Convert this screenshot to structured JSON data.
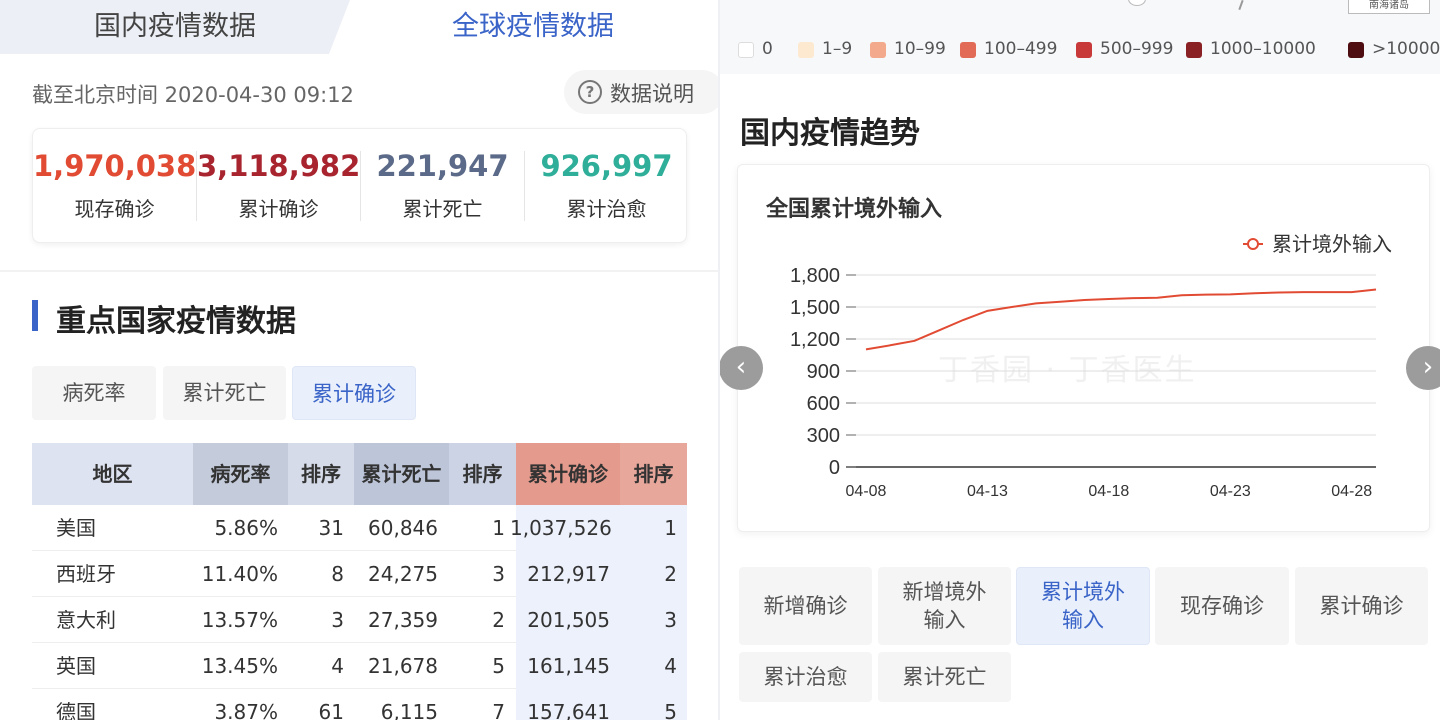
{
  "tabs": {
    "domestic": "国内疫情数据",
    "global": "全球疫情数据"
  },
  "timestamp": "截至北京时间 2020-04-30 09:12",
  "data_info": {
    "icon": "?",
    "label": "数据说明"
  },
  "stats": [
    {
      "value": "1,970,038",
      "label": "现存确诊",
      "color": "#e24b33"
    },
    {
      "value": "3,118,982",
      "label": "累计确诊",
      "color": "#a8242e"
    },
    {
      "value": "221,947",
      "label": "累计死亡",
      "color": "#5b6a88"
    },
    {
      "value": "926,997",
      "label": "累计治愈",
      "color": "#2fae9a"
    }
  ],
  "section_title": "重点国家疫情数据",
  "segments": [
    "病死率",
    "累计死亡",
    "累计确诊"
  ],
  "table": {
    "headers": [
      "地区",
      "病死率",
      "排序",
      "累计死亡",
      "排序",
      "累计确诊",
      "排序"
    ],
    "rows": [
      [
        "美国",
        "5.86%",
        "31",
        "60,846",
        "1",
        "1,037,526",
        "1"
      ],
      [
        "西班牙",
        "11.40%",
        "8",
        "24,275",
        "3",
        "212,917",
        "2"
      ],
      [
        "意大利",
        "13.57%",
        "3",
        "27,359",
        "2",
        "201,505",
        "3"
      ],
      [
        "英国",
        "13.45%",
        "4",
        "21,678",
        "5",
        "161,145",
        "4"
      ],
      [
        "德国",
        "3.87%",
        "61",
        "6,115",
        "7",
        "157,641",
        "5"
      ]
    ]
  },
  "map": {
    "nanhai_label": "南海诸岛"
  },
  "map_legend": [
    {
      "label": "0",
      "color": "#ffffff"
    },
    {
      "label": "1–9",
      "color": "#fde9cf"
    },
    {
      "label": "10–99",
      "color": "#f3a98c"
    },
    {
      "label": "100–499",
      "color": "#e26b57"
    },
    {
      "label": "500–999",
      "color": "#c8393a"
    },
    {
      "label": "1000–10000",
      "color": "#8a2124"
    },
    {
      "label": ">10000",
      "color": "#4e0d10"
    }
  ],
  "trend_title": "国内疫情趋势",
  "chart_data": {
    "type": "line",
    "title": "全国累计境外输入",
    "xlabel": "",
    "ylabel": "",
    "x": [
      "04-08",
      "04-09",
      "04-10",
      "04-11",
      "04-12",
      "04-13",
      "04-14",
      "04-15",
      "04-16",
      "04-17",
      "04-18",
      "04-19",
      "04-20",
      "04-21",
      "04-22",
      "04-23",
      "04-24",
      "04-25",
      "04-26",
      "04-27",
      "04-28",
      "04-29"
    ],
    "x_tick_labels": [
      "04-08",
      "04-13",
      "04-18",
      "04-23",
      "04-28"
    ],
    "series": [
      {
        "name": "累计境外输入",
        "color": "#e24b33",
        "values": [
          1103,
          1141,
          1183,
          1280,
          1378,
          1464,
          1500,
          1534,
          1549,
          1566,
          1575,
          1583,
          1587,
          1610,
          1616,
          1618,
          1629,
          1636,
          1639,
          1640,
          1640,
          1664
        ]
      }
    ],
    "ylim": [
      0,
      1800
    ],
    "y_ticks": [
      "0",
      "300",
      "600",
      "900",
      "1,200",
      "1,500",
      "1,800"
    ],
    "grid": true,
    "legend": "top-right"
  },
  "chart_arrows": {
    "prev": "‹",
    "next": "›"
  },
  "watermark": "丁香园 · 丁香医生",
  "chart_buttons": [
    "新增确诊",
    "新增境外输入",
    "累计境外输入",
    "现存确诊",
    "累计确诊",
    "累计治愈",
    "累计死亡"
  ]
}
